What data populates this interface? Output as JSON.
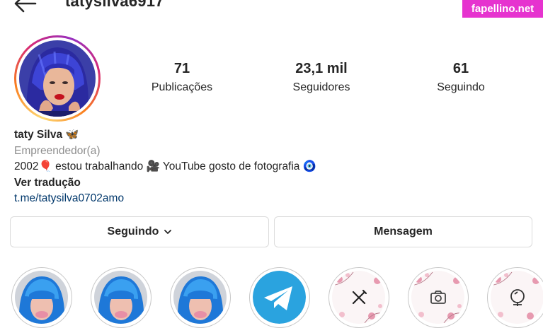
{
  "header": {
    "username": "tatysilva6917",
    "back_icon": "arrow-left-icon"
  },
  "watermark": {
    "text": "fapellino.net",
    "color": "#e633cf"
  },
  "profile": {
    "stats": [
      {
        "value": "71",
        "label": "Publicações"
      },
      {
        "value": "23,1 mil",
        "label": "Seguidores"
      },
      {
        "value": "61",
        "label": "Seguindo"
      }
    ],
    "name": "taty Silva 🦋",
    "category": "Empreendedor(a)",
    "bio": "2002🎈 estou trabalhando 🎥 YouTube gosto de fotografia 🧿",
    "translate_label": "Ver tradução",
    "link": "t.me/tatysilva0702amo"
  },
  "actions": {
    "following_label": "Seguindo",
    "message_label": "Mensagem"
  },
  "highlights": [
    {
      "icon": "photo-thumbnail"
    },
    {
      "icon": "photo-thumbnail"
    },
    {
      "icon": "photo-thumbnail"
    },
    {
      "icon": "telegram-icon"
    },
    {
      "icon": "fork-knife-icon"
    },
    {
      "icon": "camera-icon"
    },
    {
      "icon": "mirror-icon"
    }
  ],
  "colors": {
    "link": "#00376b",
    "muted": "#8e8e8e",
    "border": "#dbdbdb",
    "telegram": "#2aa3df"
  }
}
